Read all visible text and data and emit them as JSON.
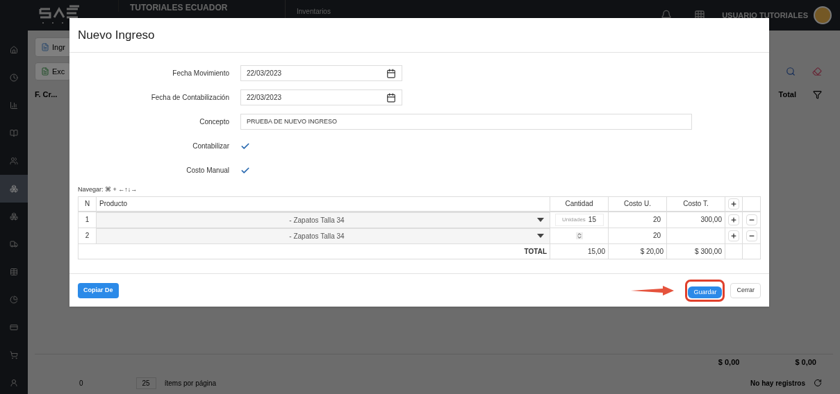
{
  "header": {
    "brand": "TUTORIALES ECUADOR",
    "module": "Inventarios",
    "user": "USUARIO TUTORIALES"
  },
  "sidebar": {
    "items": [
      {
        "selected": false
      },
      {
        "selected": false
      },
      {
        "selected": false
      },
      {
        "selected": false
      },
      {
        "selected": false
      },
      {
        "selected": true
      },
      {
        "selected": false
      },
      {
        "selected": false
      },
      {
        "selected": false
      },
      {
        "selected": false
      },
      {
        "selected": false
      },
      {
        "selected": false
      },
      {
        "selected": false
      }
    ]
  },
  "background": {
    "tab": "Ingr",
    "toolbar_button": "Exc",
    "columns": [
      "F. Cr...",
      "Total"
    ],
    "footer_totals": [
      "$ 0,00",
      "$ 0,00"
    ],
    "page": "0",
    "page_size": "25",
    "page_size_label": "ítems por página",
    "status": "No hay registros"
  },
  "dialog": {
    "title": "Nuevo Ingreso",
    "fields": [
      {
        "kind": "date",
        "label": "Fecha Movimiento",
        "value": "22/03/2023"
      },
      {
        "kind": "date",
        "label": "Fecha de Contabilización",
        "value": "22/03/2023"
      },
      {
        "kind": "text",
        "label": "Concepto",
        "value": "PRUEBA DE NUEVO INGRESO"
      },
      {
        "kind": "checkbox",
        "label": "Contabilizar",
        "checked": true
      },
      {
        "kind": "checkbox",
        "label": "Costo Manual",
        "checked": true
      }
    ],
    "nav_hint": "Navegar: ⌘ + ←↑↓→",
    "table": {
      "columns": [
        "N",
        "Producto",
        "Cantidad",
        "Costo U.",
        "Costo T."
      ],
      "rows": [
        {
          "n": "1",
          "product": "- Zapatos Talla 34",
          "quantity": "15",
          "quantity_placeholder": "Unidades",
          "unit_cost": "20",
          "total_cost": "300,00"
        },
        {
          "n": "2",
          "product": "- Zapatos Talla 34",
          "unit_cost": "20"
        }
      ],
      "total": {
        "label": "TOTAL",
        "quantity": "15,00",
        "unit_cost": "$ 20,00",
        "total_cost": "$ 300,00"
      }
    },
    "buttons": {
      "copy": "Copiar De",
      "save": "Guardar",
      "close": "Cerrar"
    }
  }
}
